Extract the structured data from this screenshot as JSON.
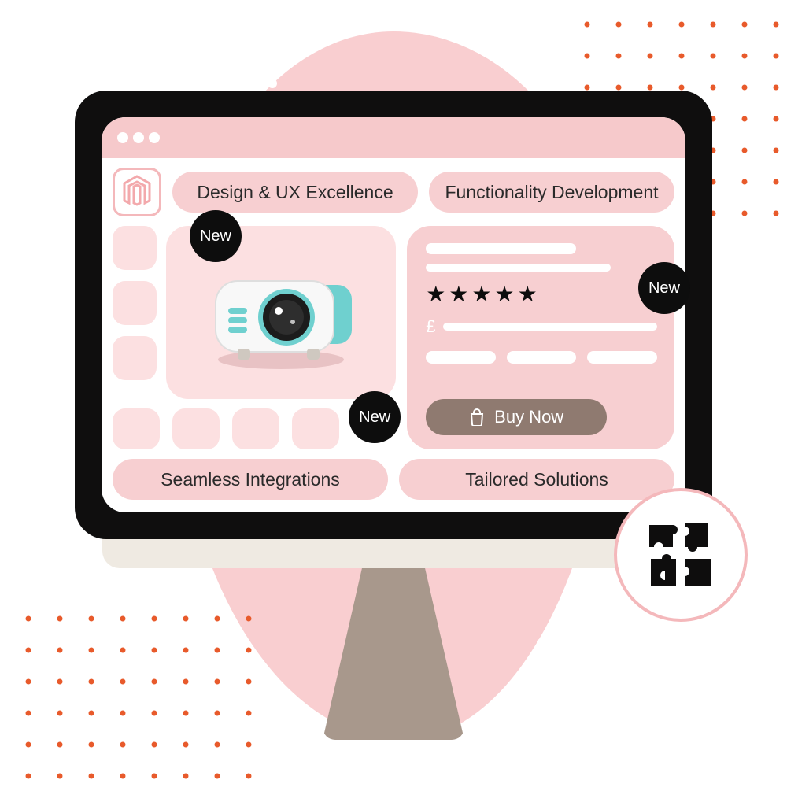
{
  "pills": {
    "top_left": "Design & UX Excellence",
    "top_right": "Functionality Development",
    "bottom_left": "Seamless Integrations",
    "bottom_right": "Tailored Solutions"
  },
  "badges": {
    "new": "New"
  },
  "detail_card": {
    "currency": "£",
    "rating": 5
  },
  "cta": {
    "buy_label": "Buy Now"
  },
  "icons": {
    "logo": "magento-logo",
    "bag": "shopping-bag-icon",
    "star": "star-icon",
    "puzzle": "puzzle-icon",
    "projector": "projector-product"
  }
}
